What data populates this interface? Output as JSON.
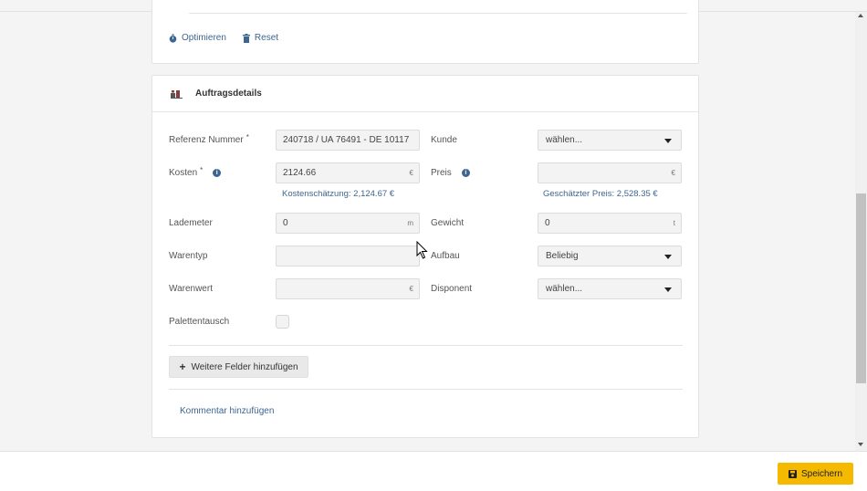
{
  "toolbar": {
    "optimize_label": "Optimieren",
    "reset_label": "Reset"
  },
  "section": {
    "title": "Auftragsdetails"
  },
  "fields": {
    "reference": {
      "label": "Referenz Nummer",
      "required": "*",
      "value": "240718 / UA 76491 - DE 10117"
    },
    "customer": {
      "label": "Kunde",
      "value": "wählen..."
    },
    "costs": {
      "label": "Kosten",
      "required": "*",
      "value": "2124.66",
      "suffix": "€",
      "hint": "Kostenschätzung: 2,124.67 €"
    },
    "price": {
      "label": "Preis",
      "value": "",
      "suffix": "€",
      "hint": "Geschätzter Preis: 2,528.35 €"
    },
    "loading_meter": {
      "label": "Lademeter",
      "value": "0",
      "suffix": "m"
    },
    "weight": {
      "label": "Gewicht",
      "value": "0",
      "suffix": "t"
    },
    "goods_type": {
      "label": "Warentyp",
      "value": ""
    },
    "body": {
      "label": "Aufbau",
      "value": "Beliebig"
    },
    "goods_value": {
      "label": "Warenwert",
      "value": "",
      "suffix": "€"
    },
    "dispatcher": {
      "label": "Disponent",
      "value": "wählen..."
    },
    "pallet_exchange": {
      "label": "Palettentausch",
      "checked": false
    }
  },
  "actions": {
    "add_fields_label": "Weitere Felder hinzufügen",
    "add_comment_label": "Kommentar hinzufügen",
    "save_label": "Speichern"
  },
  "colors": {
    "accent": "#f5b900",
    "link": "#3d6591"
  },
  "icons": {
    "optimize": "stopwatch-icon",
    "reset": "trash-icon",
    "section": "boxes-icon",
    "info": "info-icon",
    "save": "floppy-icon",
    "add": "plus-icon"
  }
}
